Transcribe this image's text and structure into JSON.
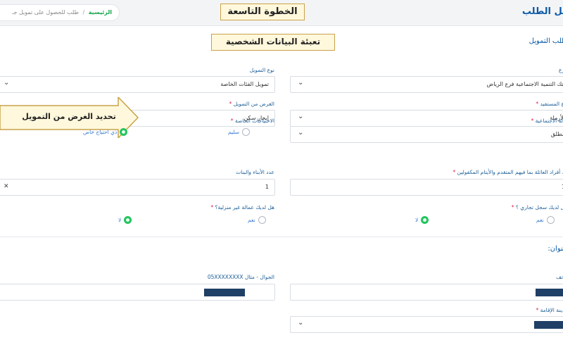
{
  "header": {
    "page_title": "يل الطلب",
    "breadcrumb": {
      "home": "الرئيسية",
      "separator": "/",
      "current": "طلب للحصول على تمويل جـ"
    }
  },
  "callouts": {
    "step": "الخطوة التاسعة",
    "personal_data": "تعبئة البيانات الشخصية",
    "arrow_text": "تحديد الغرض من التمويل"
  },
  "sections": {
    "finance": "طلب التمويل",
    "address": "عنوان:"
  },
  "right_column": {
    "branch": {
      "label": "رع",
      "value": "بنك التنمية الاجتماعية فرع الرياض"
    },
    "beneficiary_type": {
      "label": "ع المستفيد",
      "value": "الأرملة"
    },
    "social_status": {
      "label": "الة الاجتماعية",
      "value": "مطلق"
    },
    "dependents": {
      "label": "د أفراد العائلة بما فيهم المتقدم والأيتام المكفولين",
      "value": "1"
    },
    "commercial_record": {
      "label": "ل لديك سجل تجاري ؟",
      "opt_yes": "نعم",
      "opt_no": "لا"
    },
    "phone": {
      "label": "اتف"
    },
    "city": {
      "label": "دينة الإقامة"
    }
  },
  "left_column": {
    "finance_type": {
      "label": "نوع التمويل",
      "value": "تمويل الفئات الخاصة"
    },
    "finance_purpose": {
      "label": "الغرض من التمويل",
      "value": "إيجار سكن"
    },
    "special_needs": {
      "label": "الاحتياجات الخاصة",
      "opt_healthy": "سليم",
      "opt_special": "ذي احتياج خاص"
    },
    "children_count": {
      "label": "عدد الأبناء والبنات",
      "value": "1"
    },
    "domestic_worker": {
      "label": "هل لديك عمالة غير منزلية؟",
      "opt_yes": "نعم",
      "opt_no": "لا"
    },
    "mobile": {
      "label": "الجوال - مثال 05XXXXXXXX"
    }
  },
  "colors": {
    "accent": "#0b5aa6",
    "required": "#e11d48",
    "radio_on": "#22c55e",
    "callout_bg": "#fff8dc",
    "callout_border": "#c8a24a"
  }
}
